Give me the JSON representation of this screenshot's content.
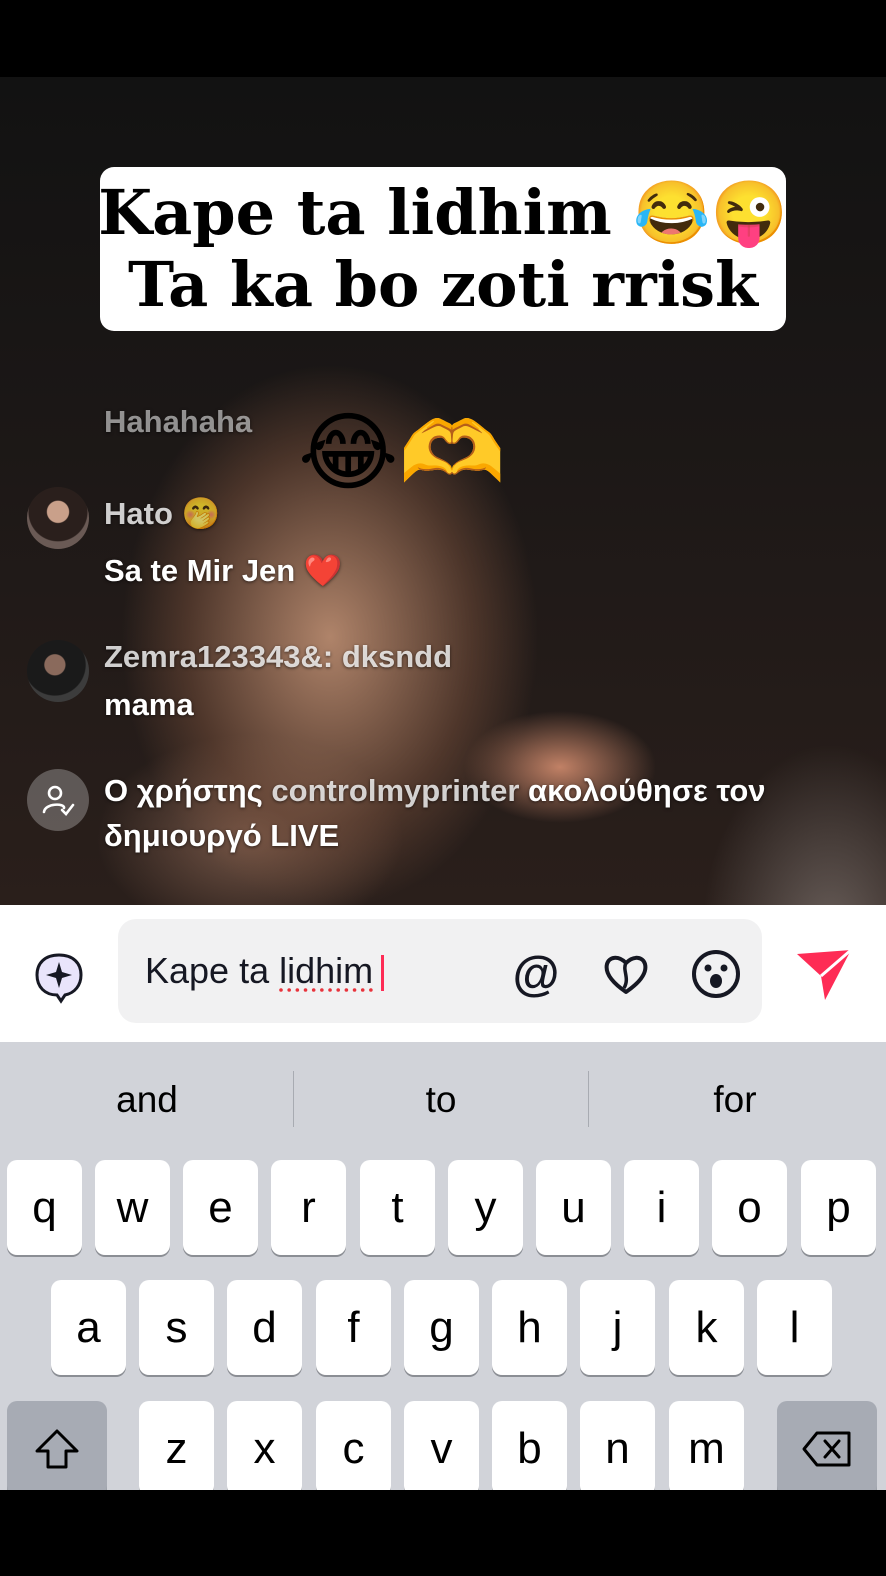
{
  "caption": {
    "line1": "Kape ta lidhim 😂😜",
    "line2": "Ta ka bo zoti rrisk"
  },
  "floating_emoji": "😂🫶",
  "chat": [
    {
      "text": "Hahahaha"
    },
    {
      "text": "Hato 🤭"
    },
    {
      "text": "Sa te Mir Jen ❤️"
    },
    {
      "text": "Zemra123343&: dksndd"
    },
    {
      "text": "mama"
    },
    {
      "prefix": "Ο χρήστης ",
      "user": "controlmyprinter",
      "suffix": " ακολούθησε τον",
      "line2": "δημιουργό LIVE"
    }
  ],
  "input": {
    "prefix": "Kape ta ",
    "misspelled": "lidhim",
    "icons": [
      "ai-sparkle-icon",
      "mention-icon",
      "heart-icon",
      "emoji-icon",
      "send-icon"
    ],
    "mention_glyph": "@"
  },
  "keyboard": {
    "suggestions": [
      "and",
      "to",
      "for"
    ],
    "row1": [
      "q",
      "w",
      "e",
      "r",
      "t",
      "y",
      "u",
      "i",
      "o",
      "p"
    ],
    "row2": [
      "a",
      "s",
      "d",
      "f",
      "g",
      "h",
      "j",
      "k",
      "l"
    ],
    "row3": [
      "z",
      "x",
      "c",
      "v",
      "b",
      "n",
      "m"
    ]
  },
  "colors": {
    "accent": "#fe2c55",
    "keyboard_bg": "#d1d3d9",
    "dark_key": "#a7abb4"
  }
}
